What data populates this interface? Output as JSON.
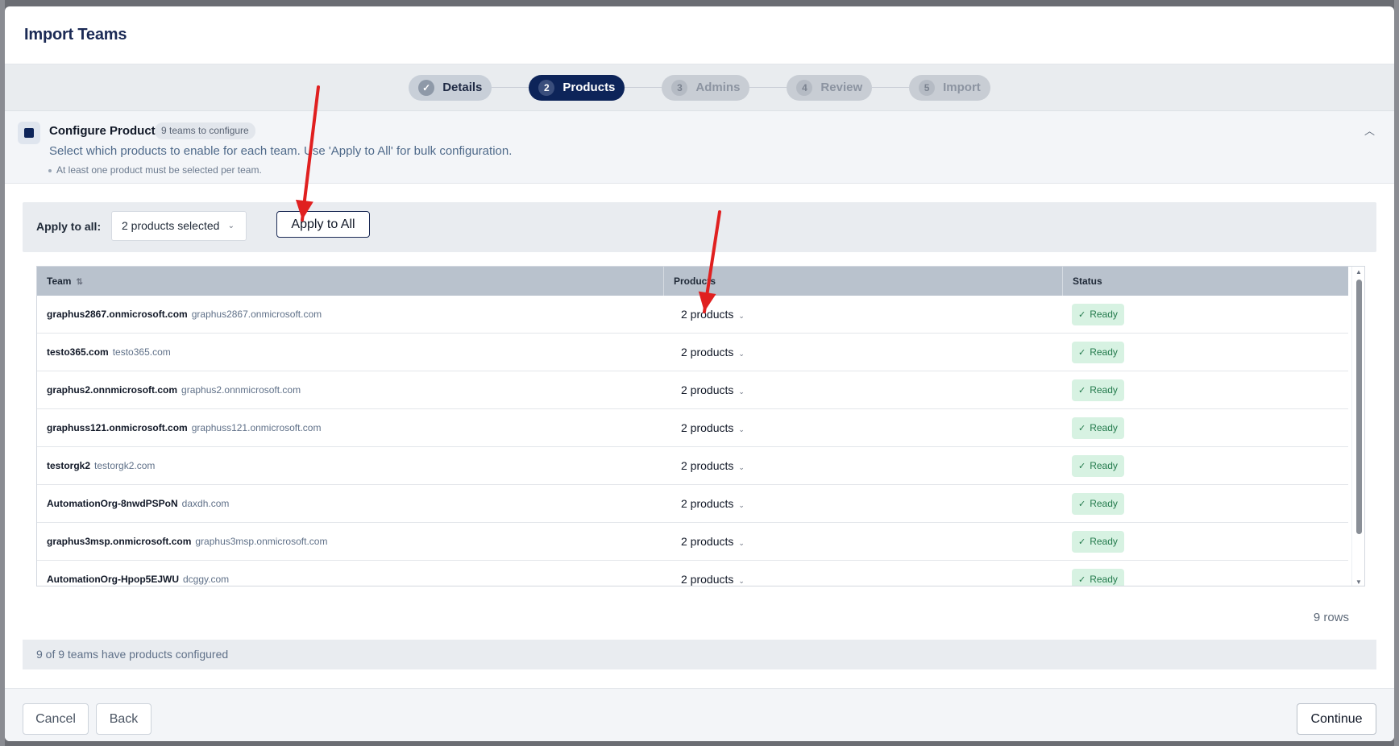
{
  "modal": {
    "title": "Import Teams"
  },
  "stepper": {
    "steps": [
      {
        "num": "✓",
        "label": "Details",
        "state": "done"
      },
      {
        "num": "2",
        "label": "Products",
        "state": "active"
      },
      {
        "num": "3",
        "label": "Admins",
        "state": "pending"
      },
      {
        "num": "4",
        "label": "Review",
        "state": "pending"
      },
      {
        "num": "5",
        "label": "Import",
        "state": "pending"
      }
    ]
  },
  "config": {
    "title": "Configure Products",
    "badge": "9 teams to configure",
    "description": "Select which products to enable for each team. Use 'Apply to All' for bulk configuration.",
    "note": "At least one product must be selected per team."
  },
  "apply_bar": {
    "label": "Apply to all:",
    "select_value": "2 products selected",
    "button_label": "Apply to All"
  },
  "table": {
    "columns": [
      "Team",
      "Products",
      "Status"
    ],
    "rows": [
      {
        "name": "graphus2867.onmicrosoft.com",
        "domain": "graphus2867.onmicrosoft.com",
        "products": "2 products",
        "status": "Ready"
      },
      {
        "name": "testo365.com",
        "domain": "testo365.com",
        "products": "2 products",
        "status": "Ready"
      },
      {
        "name": "graphus2.onnmicrosoft.com",
        "domain": "graphus2.onnmicrosoft.com",
        "products": "2 products",
        "status": "Ready"
      },
      {
        "name": "graphuss121.onmicrosoft.com",
        "domain": "graphuss121.onmicrosoft.com",
        "products": "2 products",
        "status": "Ready"
      },
      {
        "name": "testorgk2",
        "domain": "testorgk2.com",
        "products": "2 products",
        "status": "Ready"
      },
      {
        "name": "AutomationOrg-8nwdPSPoN",
        "domain": "daxdh.com",
        "products": "2 products",
        "status": "Ready"
      },
      {
        "name": "graphus3msp.onmicrosoft.com",
        "domain": "graphus3msp.onmicrosoft.com",
        "products": "2 products",
        "status": "Ready"
      },
      {
        "name": "AutomationOrg-Hpop5EJWU",
        "domain": "dcggy.com",
        "products": "2 products",
        "status": "Ready"
      }
    ],
    "row_count": "9 rows"
  },
  "summary": "9 of 9 teams have products configured",
  "footer": {
    "cancel": "Cancel",
    "back": "Back",
    "continue": "Continue"
  },
  "colors": {
    "primary": "#0d2459",
    "ready_bg": "#d7f2e2",
    "ready_text": "#237a4c",
    "annotation_arrow": "#e02020"
  }
}
